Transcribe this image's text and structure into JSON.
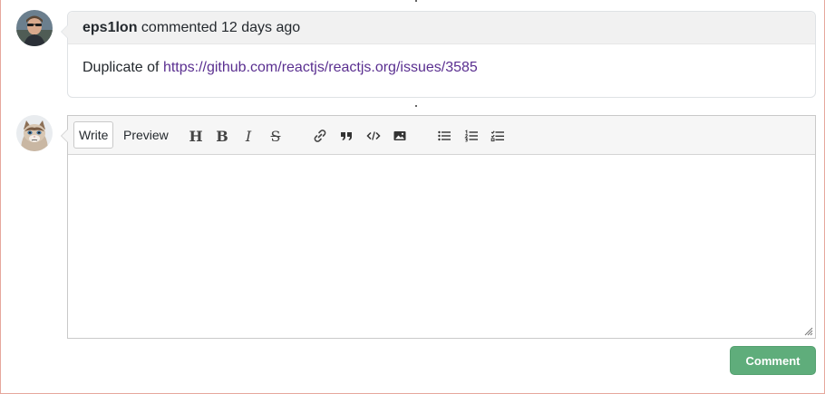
{
  "comment": {
    "author": "eps1lon",
    "meta_text": "commented 12 days ago",
    "body_prefix": "Duplicate of",
    "link_text": "https://github.com/reactjs/reactjs.org/issues/3585"
  },
  "editor": {
    "tabs": [
      {
        "label": "Write",
        "active": true
      },
      {
        "label": "Preview",
        "active": false
      }
    ],
    "toolbar_icons": [
      "heading-icon",
      "bold-icon",
      "italic-icon",
      "strikethrough-icon",
      "link-icon",
      "quote-icon",
      "code-icon",
      "image-icon",
      "bullet-list-icon",
      "numbered-list-icon",
      "task-list-icon"
    ],
    "textarea_value": "",
    "submit_label": "Comment"
  },
  "colors": {
    "link": "#5a2f90",
    "submit_bg": "#5fad7b",
    "frame_border": "#e6a79c",
    "header_bg": "#f1f1f1"
  }
}
